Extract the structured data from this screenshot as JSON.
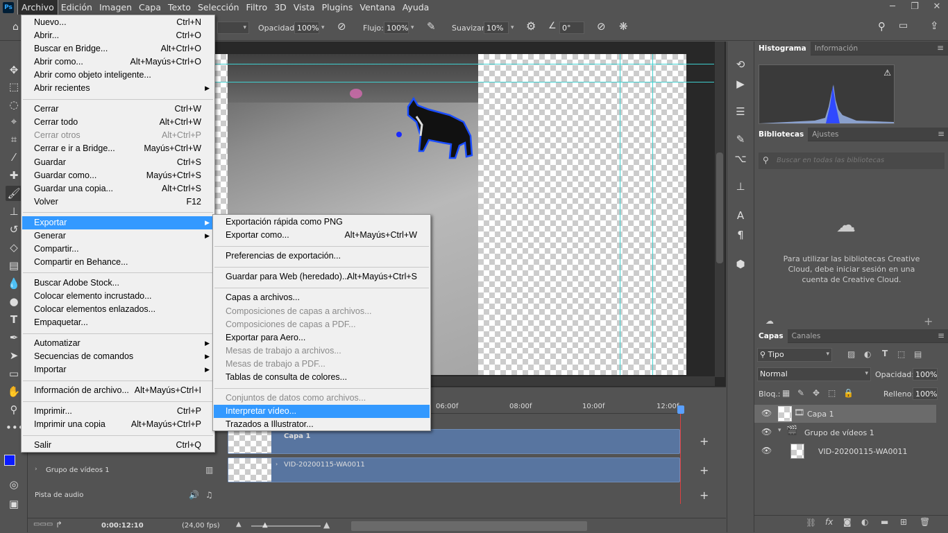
{
  "menubar": {
    "items": [
      "Archivo",
      "Edición",
      "Imagen",
      "Capa",
      "Texto",
      "Selección",
      "Filtro",
      "3D",
      "Vista",
      "Plugins",
      "Ventana",
      "Ayuda"
    ],
    "logo": "Ps"
  },
  "window_controls": [
    "─",
    "❐",
    "✕"
  ],
  "options": {
    "opacity_label": "Opacidad:",
    "opacity": "100%",
    "flow_label": "Flujo:",
    "flow": "100%",
    "smooth_label": "Suavizar:",
    "smooth": "10%",
    "angle": "0°"
  },
  "archivo_menu": [
    {
      "label": "Nuevo...",
      "sc": "Ctrl+N"
    },
    {
      "label": "Abrir...",
      "sc": "Ctrl+O"
    },
    {
      "label": "Buscar en Bridge...",
      "sc": "Alt+Ctrl+O"
    },
    {
      "label": "Abrir como...",
      "sc": "Alt+Mayús+Ctrl+O"
    },
    {
      "label": "Abrir como objeto inteligente...",
      "sc": ""
    },
    {
      "label": "Abrir recientes",
      "sc": "",
      "sub": true
    },
    {
      "sep": true
    },
    {
      "label": "Cerrar",
      "sc": "Ctrl+W"
    },
    {
      "label": "Cerrar todo",
      "sc": "Alt+Ctrl+W"
    },
    {
      "label": "Cerrar otros",
      "sc": "Alt+Ctrl+P",
      "dis": true
    },
    {
      "label": "Cerrar e ir a Bridge...",
      "sc": "Mayús+Ctrl+W"
    },
    {
      "label": "Guardar",
      "sc": "Ctrl+S"
    },
    {
      "label": "Guardar como...",
      "sc": "Mayús+Ctrl+S"
    },
    {
      "label": "Guardar una copia...",
      "sc": "Alt+Ctrl+S"
    },
    {
      "label": "Volver",
      "sc": "F12"
    },
    {
      "sep": true
    },
    {
      "label": "Exportar",
      "sc": "",
      "sub": true,
      "hl": true
    },
    {
      "label": "Generar",
      "sc": "",
      "sub": true
    },
    {
      "label": "Compartir...",
      "sc": ""
    },
    {
      "label": "Compartir en Behance...",
      "sc": ""
    },
    {
      "sep": true
    },
    {
      "label": "Buscar Adobe Stock...",
      "sc": ""
    },
    {
      "label": "Colocar elemento incrustado...",
      "sc": ""
    },
    {
      "label": "Colocar elementos enlazados...",
      "sc": ""
    },
    {
      "label": "Empaquetar...",
      "sc": ""
    },
    {
      "sep": true
    },
    {
      "label": "Automatizar",
      "sc": "",
      "sub": true
    },
    {
      "label": "Secuencias de comandos",
      "sc": "",
      "sub": true
    },
    {
      "label": "Importar",
      "sc": "",
      "sub": true
    },
    {
      "sep": true
    },
    {
      "label": "Información de archivo...",
      "sc": "Alt+Mayús+Ctrl+I"
    },
    {
      "sep": true
    },
    {
      "label": "Imprimir...",
      "sc": "Ctrl+P"
    },
    {
      "label": "Imprimir una copia",
      "sc": "Alt+Mayús+Ctrl+P"
    },
    {
      "sep": true
    },
    {
      "label": "Salir",
      "sc": "Ctrl+Q"
    }
  ],
  "exportar_menu": [
    {
      "label": "Exportación rápida como PNG",
      "sc": ""
    },
    {
      "label": "Exportar como...",
      "sc": "Alt+Mayús+Ctrl+W"
    },
    {
      "sep": true
    },
    {
      "label": "Preferencias de exportación...",
      "sc": ""
    },
    {
      "sep": true
    },
    {
      "label": "Guardar para Web (heredado)...",
      "sc": "Alt+Mayús+Ctrl+S"
    },
    {
      "sep": true
    },
    {
      "label": "Capas a archivos...",
      "sc": ""
    },
    {
      "label": "Composiciones de capas a archivos...",
      "sc": "",
      "dis": true
    },
    {
      "label": "Composiciones de capas a PDF...",
      "sc": "",
      "dis": true
    },
    {
      "label": "Exportar para Aero...",
      "sc": ""
    },
    {
      "label": "Mesas de trabajo a archivos...",
      "sc": "",
      "dis": true
    },
    {
      "label": "Mesas de trabajo a PDF...",
      "sc": "",
      "dis": true
    },
    {
      "label": "Tablas de consulta de colores...",
      "sc": ""
    },
    {
      "sep": true
    },
    {
      "label": "Conjuntos de datos como archivos...",
      "sc": "",
      "dis": true
    },
    {
      "label": "Interpretar vídeo...",
      "sc": "",
      "hl": true
    },
    {
      "label": "Trazados a Illustrator...",
      "sc": ""
    }
  ],
  "panels": {
    "histogram_tabs": [
      "Histograma",
      "Información"
    ],
    "library_tabs": [
      "Bibliotecas",
      "Ajustes"
    ],
    "library_search": "Buscar en todas las bibliotecas",
    "library_msg": "Para utilizar las bibliotecas Creative Cloud, debe iniciar sesión en una cuenta de Creative Cloud.",
    "layer_tabs": [
      "Capas",
      "Canales"
    ],
    "kind": "Tipo",
    "blend": "Normal",
    "opacity_label": "Opacidad:",
    "opacity": "100%",
    "lock_label": "Bloq.:",
    "fill_label": "Relleno:",
    "fill": "100%",
    "layers": [
      {
        "name": "Capa 1"
      },
      {
        "name": "Grupo de vídeos 1"
      },
      {
        "name": "VID-20200115-WA0011"
      }
    ]
  },
  "timeline": {
    "ticks": [
      "06:00f",
      "08:00f",
      "10:00f",
      "12:00f"
    ],
    "track1": "Capa 1",
    "track2": "VID-20200115-WA0011",
    "group": "Grupo de vídeos 1",
    "audio": "Pista de audio",
    "time": "0:00:12:10",
    "fps": "(24,00 fps)"
  },
  "colors": {
    "fg": "#0a1aff",
    "bg": "#ffffff",
    "menu_hl": "#3399ff"
  }
}
